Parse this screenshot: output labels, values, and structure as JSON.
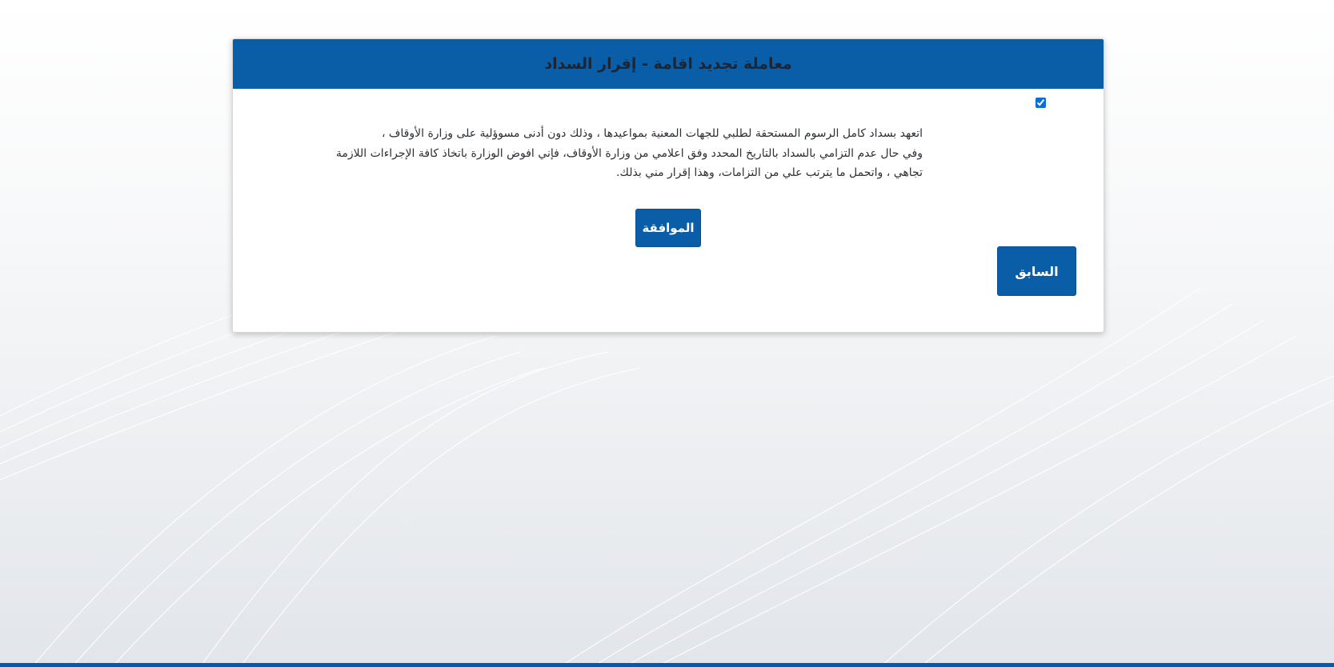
{
  "page": {
    "title": "معاملة تجديد اقامة - إقرار السداد",
    "pledge": {
      "checked": true,
      "lines": [
        "اتعهد بسداد كامل الرسوم المستحقة لطلبي للجهات المعنية بمواعيدها ، وذلك دون أدنى مسوؤلية على وزارة الأوقاف ،",
        "وفي حال عدم التزامي بالسداد بالتاريخ المحدد وفق اعلامي من وزارة الأوقاف، فإني افوض الوزارة باتخاذ كافة الإجراءات اللازمة",
        "تجاهي ، واتحمل ما يترتب علي من التزامات، وهذا إقرار مني بذلك."
      ]
    },
    "buttons": {
      "agree_label": "الموافقة",
      "back_label": "السابق"
    }
  },
  "colors": {
    "header_bg": "#0a5ea8",
    "button_bg": "#0a5ea8",
    "bottom_bar": "#0a58a8"
  }
}
